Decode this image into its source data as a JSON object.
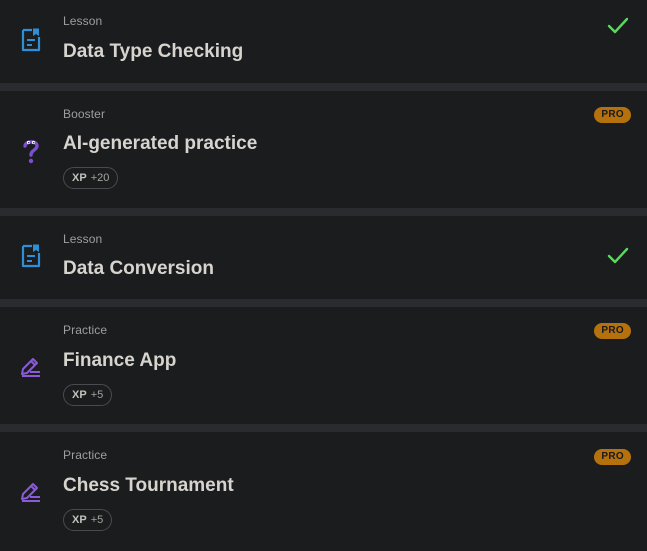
{
  "colors": {
    "page_bg": "#2a2b2e",
    "card_bg": "#1b1c1e",
    "lesson_icon": "#2f8fd6",
    "booster_icon": "#7a4fd1",
    "practice_icon": "#8a5ad8",
    "check": "#5cd65f",
    "pro_badge": "#b6710f"
  },
  "items": [
    {
      "kind": "Lesson",
      "title": "Data Type Checking",
      "icon": "document-icon",
      "completed": true
    },
    {
      "kind": "Booster",
      "title": "AI-generated practice",
      "icon": "question-icon",
      "badge": "PRO",
      "xp_label": "XP",
      "xp_value": "+20"
    },
    {
      "kind": "Lesson",
      "title": "Data Conversion",
      "icon": "document-icon",
      "completed": true
    },
    {
      "kind": "Practice",
      "title": "Finance App",
      "icon": "edit-icon",
      "badge": "PRO",
      "xp_label": "XP",
      "xp_value": "+5"
    },
    {
      "kind": "Practice",
      "title": "Chess Tournament",
      "icon": "edit-icon",
      "badge": "PRO",
      "xp_label": "XP",
      "xp_value": "+5"
    }
  ]
}
